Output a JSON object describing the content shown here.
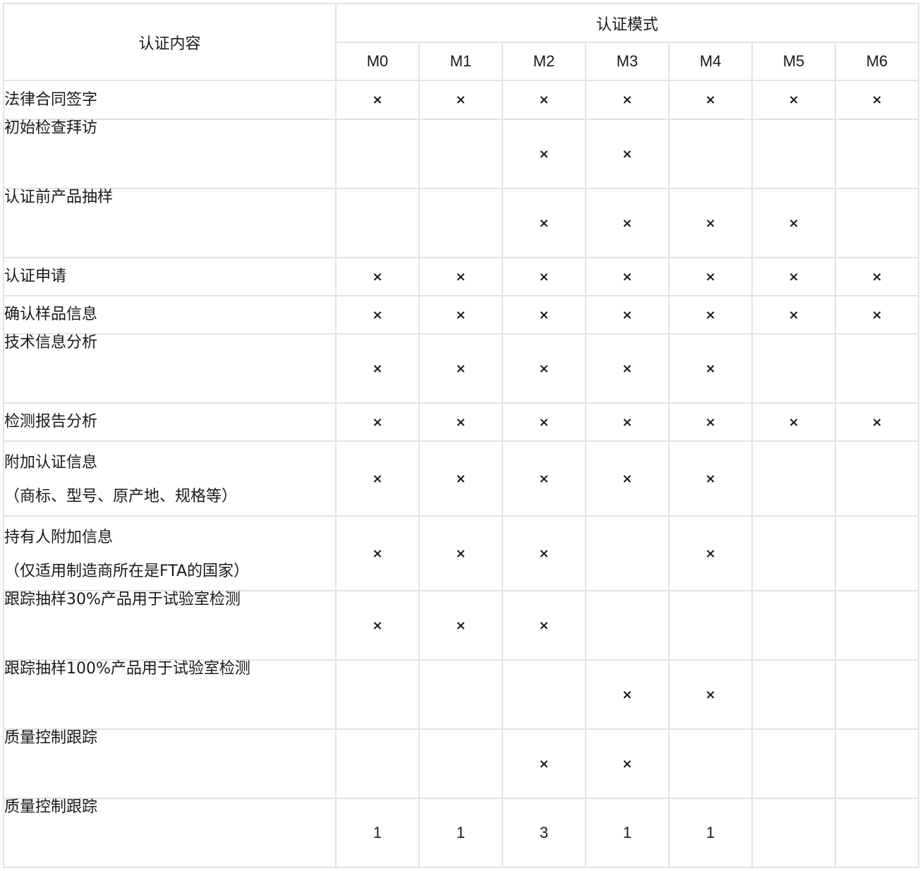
{
  "header": {
    "content_label": "认证内容",
    "modes_label": "认证模式",
    "modes": [
      "M0",
      "M1",
      "M2",
      "M3",
      "M4",
      "M5",
      "M6"
    ]
  },
  "rows": [
    {
      "label": "法律合同签字",
      "sub": "",
      "values": [
        "×",
        "×",
        "×",
        "×",
        "×",
        "×",
        "×"
      ]
    },
    {
      "label": "初始检查拜访",
      "sub": "",
      "values": [
        "",
        "",
        "×",
        "×",
        "",
        "",
        ""
      ]
    },
    {
      "label": "认证前产品抽样",
      "sub": "",
      "values": [
        "",
        "",
        "×",
        "×",
        "×",
        "×",
        ""
      ]
    },
    {
      "label": "认证申请",
      "sub": "",
      "values": [
        "×",
        "×",
        "×",
        "×",
        "×",
        "×",
        "×"
      ]
    },
    {
      "label": "确认样品信息",
      "sub": "",
      "values": [
        "×",
        "×",
        "×",
        "×",
        "×",
        "×",
        "×"
      ]
    },
    {
      "label": "技术信息分析",
      "sub": "",
      "values": [
        "×",
        "×",
        "×",
        "×",
        "×",
        "",
        ""
      ]
    },
    {
      "label": "检测报告分析",
      "sub": "",
      "values": [
        "×",
        "×",
        "×",
        "×",
        "×",
        "×",
        "×"
      ]
    },
    {
      "label": "附加认证信息",
      "sub": "（商标、型号、原产地、规格等）",
      "values": [
        "×",
        "×",
        "×",
        "×",
        "×",
        "",
        ""
      ]
    },
    {
      "label": "持有人附加信息",
      "sub": "（仅适用制造商所在是FTA的国家）",
      "values": [
        "×",
        "×",
        "×",
        "",
        "×",
        "",
        ""
      ]
    },
    {
      "label": "跟踪抽样30%产品用于试验室检测",
      "sub": "",
      "values": [
        "×",
        "×",
        "×",
        "",
        "",
        "",
        ""
      ]
    },
    {
      "label": "跟踪抽样100%产品用于试验室检测",
      "sub": "",
      "values": [
        "",
        "",
        "",
        "×",
        "×",
        "",
        ""
      ]
    },
    {
      "label": "质量控制跟踪",
      "sub": "",
      "values": [
        "",
        "",
        "×",
        "×",
        "",
        "",
        ""
      ]
    },
    {
      "label": "质量控制跟踪",
      "sub": "",
      "values": [
        "1",
        "1",
        "3",
        "1",
        "1",
        "",
        ""
      ]
    }
  ]
}
